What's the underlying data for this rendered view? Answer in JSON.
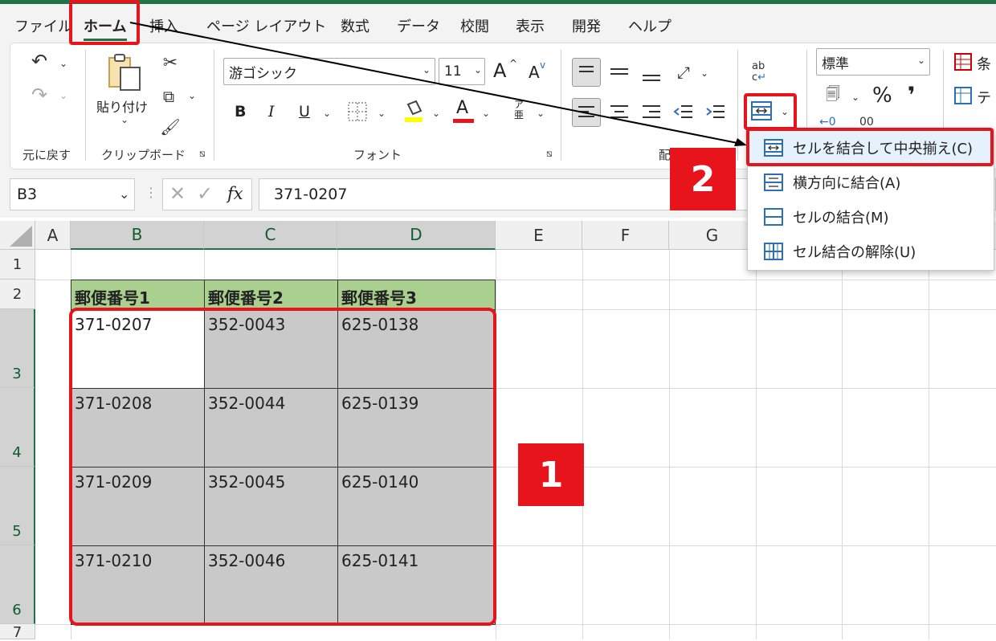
{
  "menu": {
    "items": [
      "ファイル",
      "ホーム",
      "挿入",
      "ページ レイアウト",
      "数式",
      "データ",
      "校閲",
      "表示",
      "開発",
      "ヘルプ"
    ],
    "active": "ホーム"
  },
  "ribbon": {
    "undo_group_label": "元に戻す",
    "clipboard": {
      "paste_label": "貼り付け",
      "group_label": "クリップボード"
    },
    "font": {
      "name": "游ゴシック",
      "size": "11",
      "group_label": "フォント",
      "bold": "B",
      "italic": "I",
      "underline": "U",
      "grow": "A",
      "shrink": "A",
      "color_a": "A"
    },
    "alignment": {
      "group_label": "配"
    },
    "number": {
      "format": "標準",
      "percent": "%",
      "comma": "❜"
    },
    "styles": {
      "conditional": "条",
      "table": "テ"
    }
  },
  "merge_menu": {
    "items": [
      {
        "label": "セルを結合して中央揃え(C)",
        "underline_char": "C"
      },
      {
        "label": "横方向に結合(A)",
        "underline_char": "A"
      },
      {
        "label": "セルの結合(M)",
        "underline_char": "M"
      },
      {
        "label": "セル結合の解除(U)",
        "underline_char": "U"
      }
    ]
  },
  "formula_bar": {
    "name_box": "B3",
    "fx": "fx",
    "value": "371-0207"
  },
  "sheet": {
    "columns": [
      "A",
      "B",
      "C",
      "D",
      "E",
      "F",
      "G"
    ],
    "rows": [
      "1",
      "2",
      "3",
      "4",
      "5",
      "6",
      "7"
    ],
    "headers": [
      "郵便番号1",
      "郵便番号2",
      "郵便番号3"
    ],
    "data": [
      [
        "371-0207",
        "352-0043",
        "625-0138"
      ],
      [
        "371-0208",
        "352-0044",
        "625-0139"
      ],
      [
        "371-0209",
        "352-0045",
        "625-0140"
      ],
      [
        "371-0210",
        "352-0046",
        "625-0141"
      ]
    ]
  },
  "annotations": {
    "badge1": "1",
    "badge2": "2"
  },
  "colors": {
    "accent": "#217346",
    "header_fill": "#a9d08e",
    "selection_fill": "#c9c9c9",
    "annotation_red": "#e8141c"
  }
}
